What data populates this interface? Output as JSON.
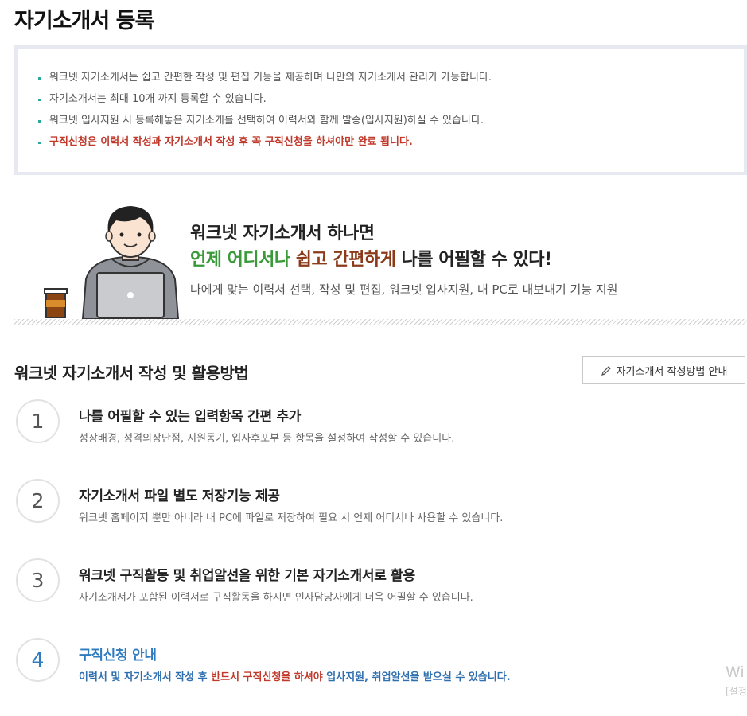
{
  "page": {
    "title": "자기소개서 등록"
  },
  "notice": {
    "items": [
      "워크넷 자기소개서는 쉽고 간편한 작성 및 편집 기능을 제공하며 나만의 자기소개서 관리가 가능합니다.",
      "자기소개서는 최대 10개 까지 등록할 수 있습니다.",
      "워크넷 입사지원 시 등록해놓은 자기소개를 선택하여 이력서와 함께 발송(입사지원)하실 수 있습니다.",
      "구직신청은 이력서 작성과 자기소개서 작성 후 꼭 구직신청을 하셔야만 완료 됩니다."
    ]
  },
  "promo": {
    "line1": "워크넷 자기소개서 하나면",
    "line2_green": "언제 어디서나",
    "line2_brown": "쉽고 간편하게",
    "line2_dark": "나를 어필할 수 있다!",
    "sub": "나에게 맞는 이력서 선택, 작성 및 편집, 워크넷 입사지원, 내 PC로 내보내기 기능 지원"
  },
  "section": {
    "title": "워크넷 자기소개서 작성 및 활용방법",
    "guide_button": "자기소개서 작성방법 안내"
  },
  "steps": [
    {
      "num": "1",
      "title": "나를 어필할 수 있는 입력항목 간편 추가",
      "desc": "성장배경, 성격의장단점, 지원동기, 입사후포부 등 항목을 설정하여 작성할 수 있습니다."
    },
    {
      "num": "2",
      "title": "자기소개서 파일 별도 저장기능 제공",
      "desc": "워크넷 홈페이지 뿐만 아니라 내 PC에 파일로 저장하여 필요 시 언제 어디서나 사용할 수 있습니다."
    },
    {
      "num": "3",
      "title": "워크넷 구직활동 및 취업알선을 위한 기본 자기소개서로 활용",
      "desc": "자기소개서가 포함된 이력서로 구직활동을 하시면 인사담당자에게 더욱 어필할 수 있습니다."
    },
    {
      "num": "4",
      "title": "구직신청 안내",
      "desc_a": "이력서 및 자기소개서 작성 후 ",
      "desc_b": "반드시 구직신청을 하셔야",
      "desc_c": " 입사지원, 취업알선을 받으실 수 있습니다."
    }
  ],
  "watermark": {
    "text": "Wi",
    "sub": "[설정"
  },
  "colors": {
    "green": "#3a9a3a",
    "brown": "#8b3a1a",
    "blue": "#2f7bc0",
    "red": "#c0392b",
    "teal": "#2aa8a0"
  },
  "icons": {
    "guide_button": "pencil-icon"
  }
}
